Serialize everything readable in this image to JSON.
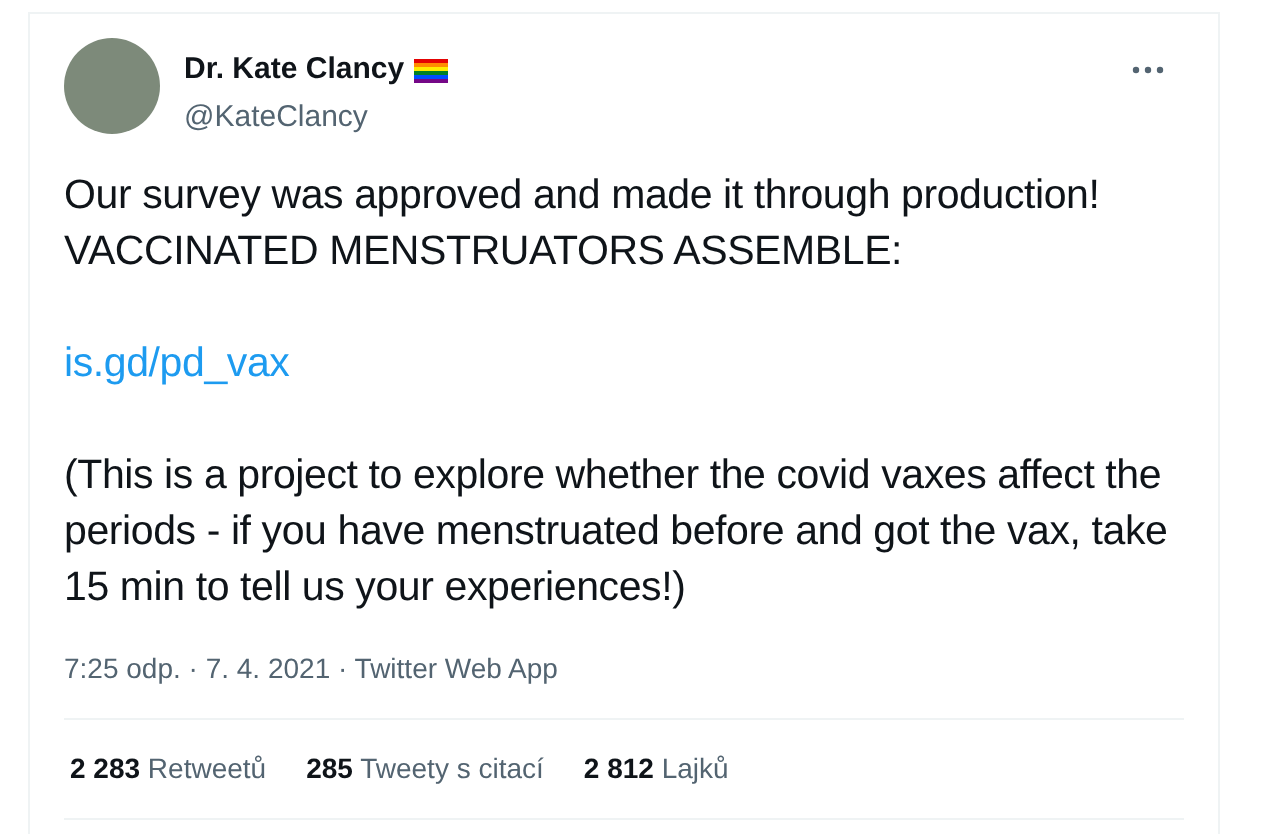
{
  "author": {
    "name": "Dr. Kate Clancy",
    "handle": "@KateClancy"
  },
  "tweet": {
    "paragraphs": [
      {
        "kind": "text",
        "text": "Our survey was approved and made it through production! VACCINATED MENSTRUATORS ASSEMBLE:"
      },
      {
        "kind": "link",
        "text": "is.gd/pd_vax"
      },
      {
        "kind": "text",
        "text": "(This is a project to explore whether the covid vaxes affect the periods - if you have menstruated before and got the vax, take 15 min to tell us your experiences!)"
      }
    ],
    "meta": "7:25 odp. · 7. 4. 2021 · Twitter Web App"
  },
  "stats": [
    {
      "count": "2 283",
      "label": "Retweetů"
    },
    {
      "count": "285",
      "label": "Tweety s citací"
    },
    {
      "count": "2 812",
      "label": "Lajků"
    }
  ]
}
